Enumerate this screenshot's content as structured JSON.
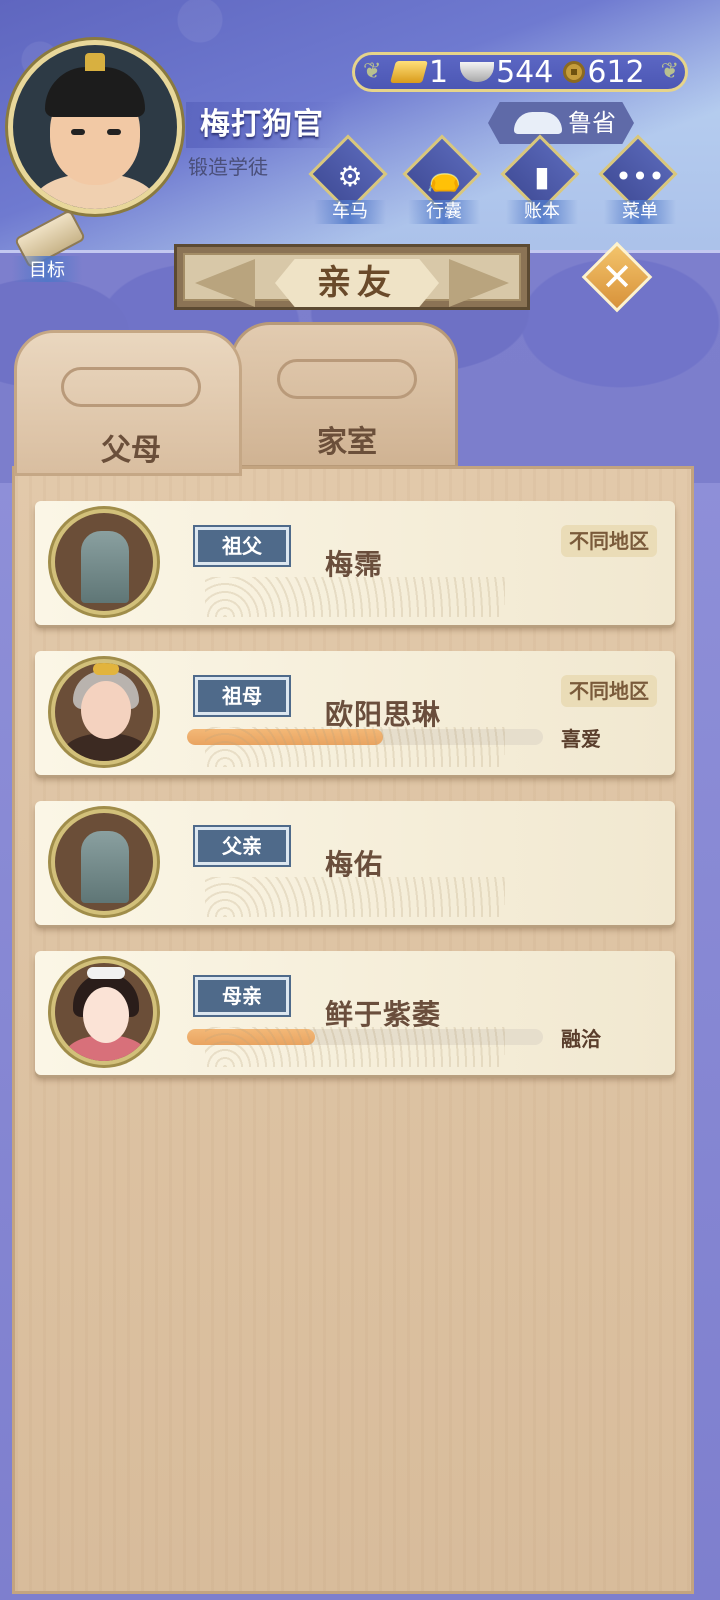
{
  "player": {
    "name": "梅打狗官",
    "title": "锻造学徒"
  },
  "currency": {
    "gold": "1",
    "silver": "544",
    "coins": "612"
  },
  "region_button": {
    "label": "鲁省"
  },
  "menu": [
    {
      "label": "车马",
      "icon": "carriage-icon"
    },
    {
      "label": "行囊",
      "icon": "bag-icon"
    },
    {
      "label": "账本",
      "icon": "ledger-icon"
    },
    {
      "label": "菜单",
      "icon": "more-icon"
    }
  ],
  "goal_button": {
    "label": "目标"
  },
  "header": {
    "title": "亲友"
  },
  "tabs": [
    {
      "label": "父母",
      "active": true
    },
    {
      "label": "家室",
      "active": false
    }
  ],
  "relatives": [
    {
      "relation": "祖父",
      "name": "梅霈",
      "region": "不同地区",
      "deceased": true
    },
    {
      "relation": "祖母",
      "name": "欧阳思琳",
      "region": "不同地区",
      "affection": 0.55,
      "mood": "喜爱"
    },
    {
      "relation": "父亲",
      "name": "梅佑",
      "region": "",
      "deceased": true
    },
    {
      "relation": "母亲",
      "name": "鲜于紫萎",
      "region": "",
      "affection": 0.36,
      "mood": "融洽"
    }
  ],
  "colors": {
    "accent": "#e9a461",
    "tag_blue": "#4f6a8a",
    "panel": "#d8bc9b"
  }
}
